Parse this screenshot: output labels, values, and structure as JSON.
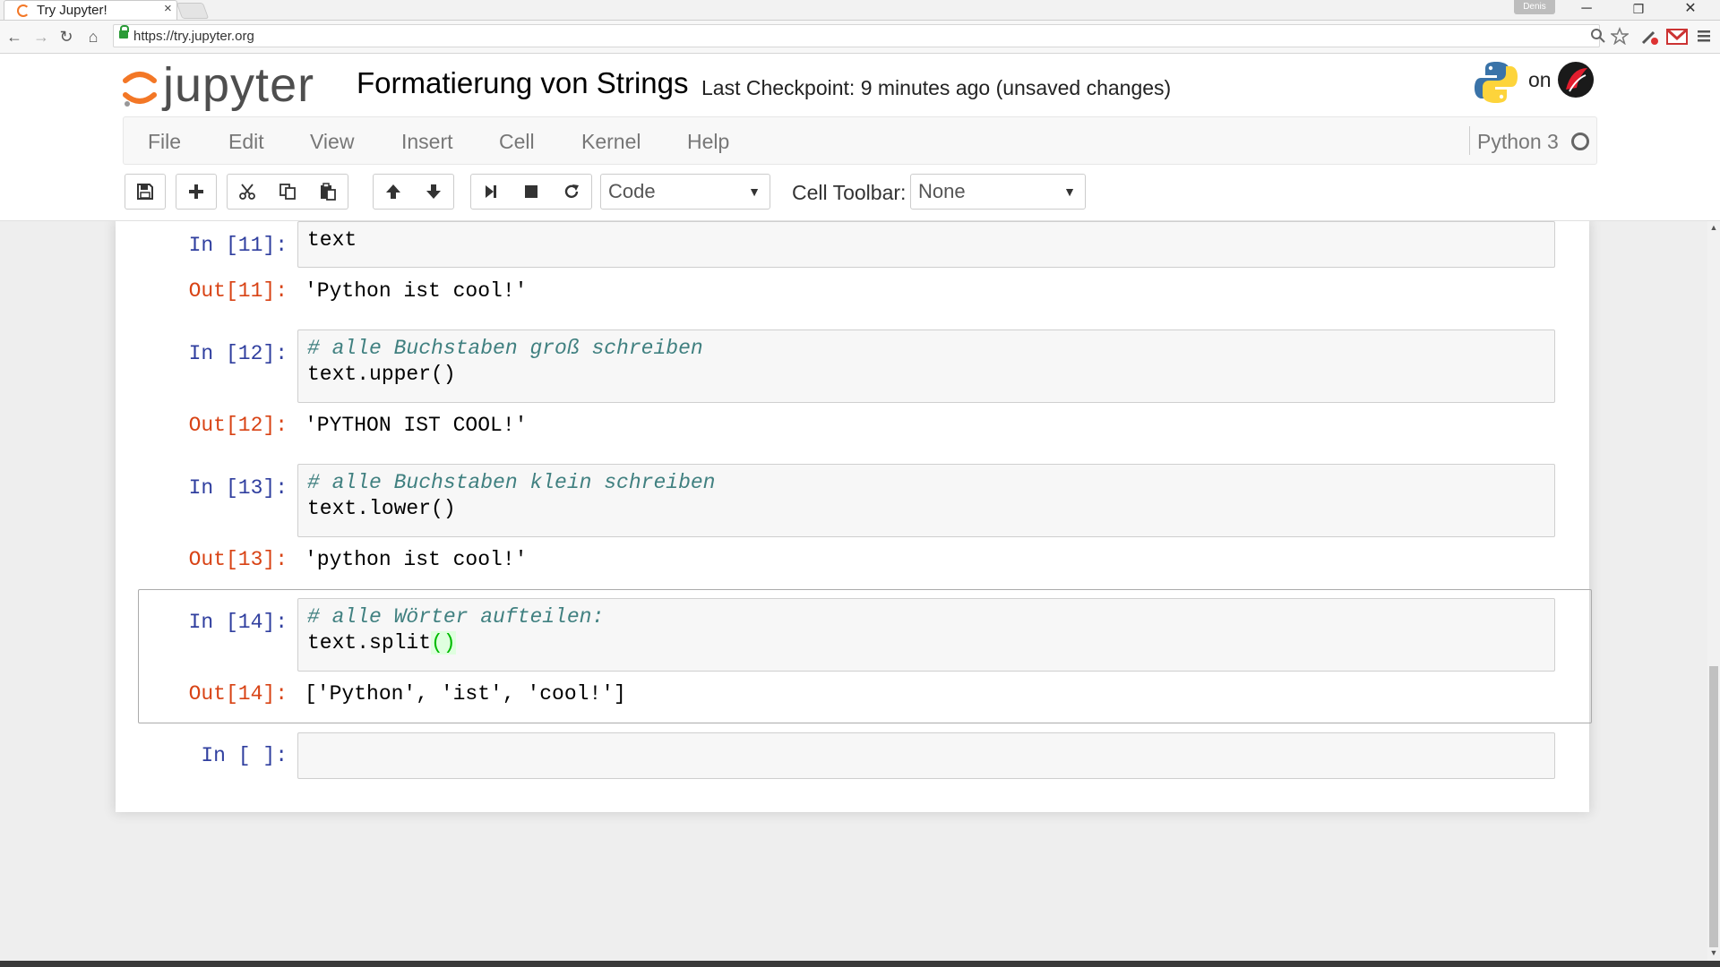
{
  "browser": {
    "tab_title": "Try Jupyter!",
    "tab_close": "×",
    "profile_name": "Denis",
    "url": "https://try.jupyter.org",
    "window_controls": {
      "minimize": "─",
      "maximize": "❐",
      "close": "✕"
    },
    "nav": {
      "back": "←",
      "forward": "→",
      "reload": "↻",
      "home": "⌂"
    },
    "icons": [
      "zoom-icon",
      "star-icon",
      "extension-icon",
      "gmail-icon",
      "menu-icon"
    ]
  },
  "header": {
    "logo_text": "jupyter",
    "notebook_title": "Formatierung von Strings",
    "checkpoint": "Last Checkpoint: 9 minutes ago (unsaved changes)",
    "on_text": "on"
  },
  "menu": {
    "items": [
      "File",
      "Edit",
      "View",
      "Insert",
      "Cell",
      "Kernel",
      "Help"
    ],
    "kernel_name": "Python 3"
  },
  "toolbar": {
    "cell_type": "Code",
    "cell_toolbar_label": "Cell Toolbar:",
    "cell_toolbar_value": "None"
  },
  "cells": [
    {
      "in_prompt": "In [11]:",
      "comment": "",
      "code": "text",
      "out_prompt": "Out[11]:",
      "output": "'Python ist cool!'"
    },
    {
      "in_prompt": "In [12]:",
      "comment": "# alle Buchstaben groß schreiben",
      "code": "text.upper()",
      "out_prompt": "Out[12]:",
      "output": "'PYTHON IST COOL!'"
    },
    {
      "in_prompt": "In [13]:",
      "comment": "# alle Buchstaben klein schreiben",
      "code": "text.lower()",
      "out_prompt": "Out[13]:",
      "output": "'python ist cool!'"
    },
    {
      "in_prompt": "In [14]:",
      "comment": "# alle Wörter aufteilen:",
      "code_prefix": "text.split",
      "code_parens": "()",
      "out_prompt": "Out[14]:",
      "output": "['Python', 'ist', 'cool!']"
    },
    {
      "in_prompt": "In [ ]:"
    }
  ],
  "colors": {
    "prompt_in": "#303f9f",
    "prompt_out": "#d84315",
    "comment": "#408080",
    "jupyter_orange": "#f37726"
  }
}
